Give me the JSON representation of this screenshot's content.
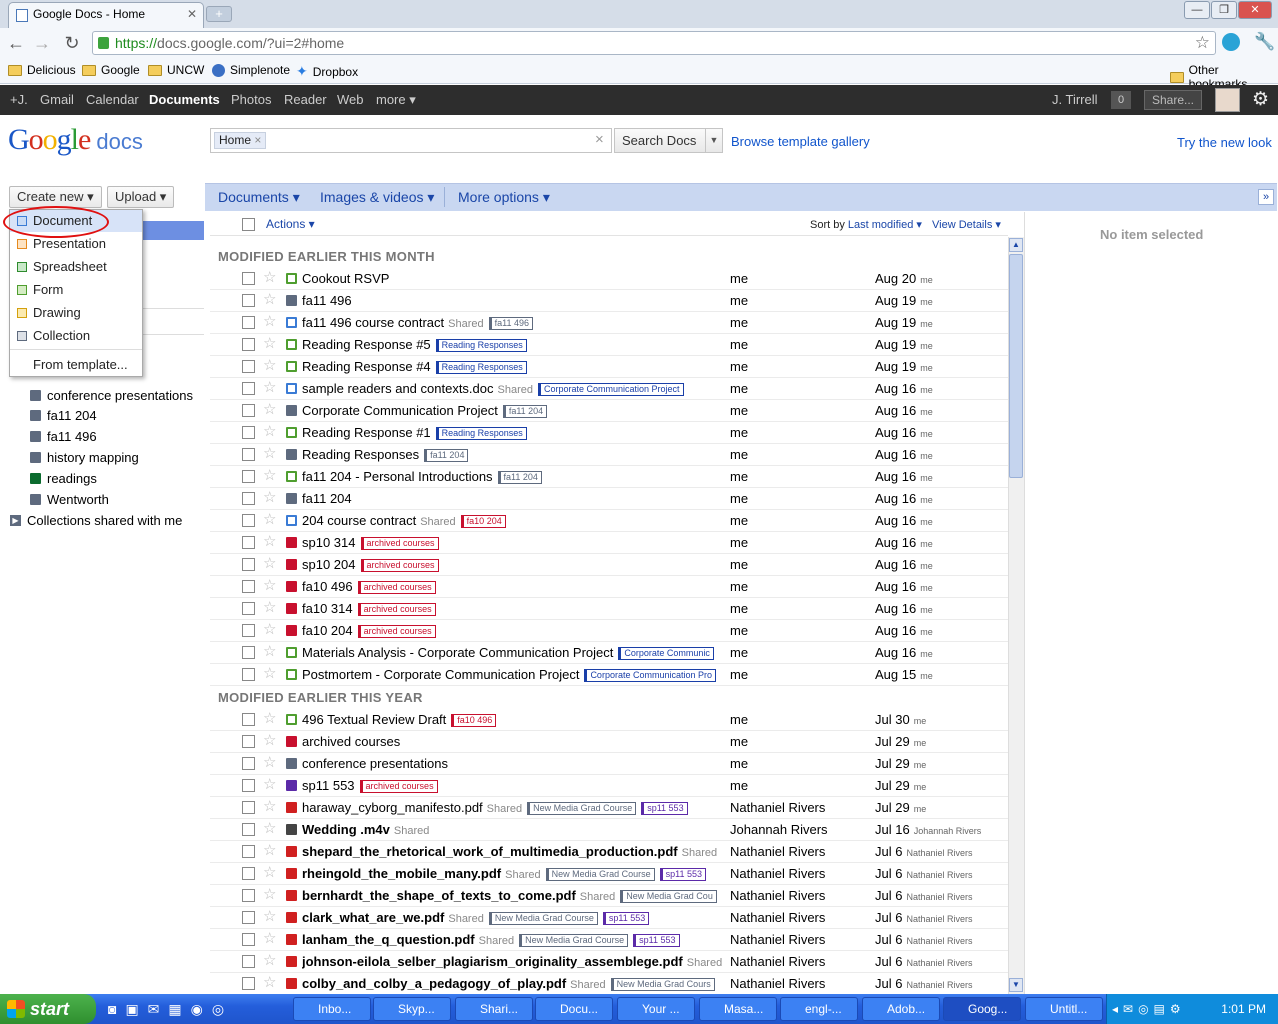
{
  "browser": {
    "tab_title": "Google Docs - Home",
    "url_scheme": "https://",
    "url_rest": "docs.google.com/?ui=2#home",
    "bookmarks": [
      "Delicious",
      "Google",
      "UNCW",
      "Simplenote",
      "Dropbox"
    ],
    "other_bookmarks": "Other bookmarks"
  },
  "gbar": {
    "links": [
      "+J.",
      "Gmail",
      "Calendar",
      "Documents",
      "Photos",
      "Reader",
      "Web",
      "more ▾"
    ],
    "user": "J. Tirrell",
    "count": "0",
    "share": "Share..."
  },
  "header": {
    "logo_google": "Google",
    "logo_docs": "docs",
    "search_chip": "Home",
    "search_button": "Search Docs",
    "browse_templates": "Browse template gallery",
    "try_new_look": "Try the new look"
  },
  "left": {
    "create_new": "Create new ▾",
    "upload": "Upload ▾",
    "menu": [
      "Document",
      "Presentation",
      "Spreadsheet",
      "Form",
      "Drawing",
      "Collection",
      "From template..."
    ],
    "collections": [
      {
        "label": "conference presentations",
        "color": "#5e6a7e"
      },
      {
        "label": "fa11 204",
        "color": "#5e6a7e"
      },
      {
        "label": "fa11 496",
        "color": "#5e6a7e"
      },
      {
        "label": "history mapping",
        "color": "#5e6a7e"
      },
      {
        "label": "readings",
        "color": "#0b6b2e"
      },
      {
        "label": "Wentworth",
        "color": "#5e6a7e"
      }
    ],
    "shared_with_me": "Collections shared with me"
  },
  "menubar": {
    "documents": "Documents ▾",
    "images": "Images & videos ▾",
    "more": "More options ▾"
  },
  "list": {
    "actions": "Actions ▾",
    "sort_prefix": "Sort by",
    "sort_value": "Last modified ▾",
    "view": "View Details ▾",
    "section1": "MODIFIED EARLIER THIS MONTH",
    "section2": "MODIFIED EARLIER THIS YEAR",
    "shared_label": "Shared",
    "rows1": [
      {
        "name": "Cookout RSVP",
        "type": "form",
        "tags": [],
        "owner": "me",
        "date": "Aug 20",
        "by": "me"
      },
      {
        "name": "fa11 496",
        "type": "coll",
        "tags": [],
        "owner": "me",
        "date": "Aug 19",
        "by": "me"
      },
      {
        "name": "fa11 496 course contract",
        "type": "doc",
        "shared": true,
        "tags": [
          "fa11 496"
        ],
        "owner": "me",
        "date": "Aug 19",
        "by": "me"
      },
      {
        "name": "Reading Response #5",
        "type": "form",
        "tags": [
          "Reading Responses"
        ],
        "owner": "me",
        "date": "Aug 19",
        "by": "me"
      },
      {
        "name": "Reading Response #4",
        "type": "form",
        "tags": [
          "Reading Responses"
        ],
        "owner": "me",
        "date": "Aug 19",
        "by": "me"
      },
      {
        "name": "sample readers and contexts.doc",
        "type": "doc",
        "shared": true,
        "tags": [
          "Corporate Communication Project"
        ],
        "owner": "me",
        "date": "Aug 16",
        "by": "me"
      },
      {
        "name": "Corporate Communication Project",
        "type": "coll",
        "tags": [
          "fa11 204"
        ],
        "owner": "me",
        "date": "Aug 16",
        "by": "me"
      },
      {
        "name": "Reading Response #1",
        "type": "form",
        "tags": [
          "Reading Responses"
        ],
        "owner": "me",
        "date": "Aug 16",
        "by": "me"
      },
      {
        "name": "Reading Responses",
        "type": "coll",
        "tags": [
          "fa11 204"
        ],
        "owner": "me",
        "date": "Aug 16",
        "by": "me"
      },
      {
        "name": "fa11 204 - Personal Introductions",
        "type": "form",
        "tags": [
          "fa11 204"
        ],
        "owner": "me",
        "date": "Aug 16",
        "by": "me"
      },
      {
        "name": "fa11 204",
        "type": "coll",
        "tags": [],
        "owner": "me",
        "date": "Aug 16",
        "by": "me"
      },
      {
        "name": "204 course contract",
        "type": "doc",
        "shared": true,
        "tags": [
          "fa10 204"
        ],
        "owner": "me",
        "date": "Aug 16",
        "by": "me"
      },
      {
        "name": "sp10 314",
        "type": "red",
        "tags": [
          "archived courses"
        ],
        "owner": "me",
        "date": "Aug 16",
        "by": "me"
      },
      {
        "name": "sp10 204",
        "type": "red",
        "tags": [
          "archived courses"
        ],
        "owner": "me",
        "date": "Aug 16",
        "by": "me"
      },
      {
        "name": "fa10 496",
        "type": "red",
        "tags": [
          "archived courses"
        ],
        "owner": "me",
        "date": "Aug 16",
        "by": "me"
      },
      {
        "name": "fa10 314",
        "type": "red",
        "tags": [
          "archived courses"
        ],
        "owner": "me",
        "date": "Aug 16",
        "by": "me"
      },
      {
        "name": "fa10 204",
        "type": "red",
        "tags": [
          "archived courses"
        ],
        "owner": "me",
        "date": "Aug 16",
        "by": "me"
      },
      {
        "name": "Materials Analysis - Corporate Communication Project",
        "type": "form",
        "tags": [
          "Corporate Communic"
        ],
        "owner": "me",
        "date": "Aug 16",
        "by": "me"
      },
      {
        "name": "Postmortem - Corporate Communication Project",
        "type": "form",
        "tags": [
          "Corporate Communication Pro"
        ],
        "owner": "me",
        "date": "Aug 15",
        "by": "me"
      }
    ],
    "rows2": [
      {
        "name": "496 Textual Review Draft",
        "type": "form",
        "tags": [
          "fa10 496"
        ],
        "owner": "me",
        "date": "Jul 30",
        "by": "me"
      },
      {
        "name": "archived courses",
        "type": "red",
        "tags": [],
        "owner": "me",
        "date": "Jul 29",
        "by": "me"
      },
      {
        "name": "conference presentations",
        "type": "coll",
        "tags": [],
        "owner": "me",
        "date": "Jul 29",
        "by": "me"
      },
      {
        "name": "sp11 553",
        "type": "purple",
        "tags": [
          "archived courses"
        ],
        "owner": "me",
        "date": "Jul 29",
        "by": "me"
      },
      {
        "name": "haraway_cyborg_manifesto.pdf",
        "type": "pdf",
        "shared": true,
        "tags": [
          "New Media Grad Course",
          "sp11 553"
        ],
        "owner": "Nathaniel Rivers",
        "date": "Jul 29",
        "by": "me"
      },
      {
        "name": "Wedding .m4v",
        "type": "vid",
        "bold": true,
        "shared": true,
        "tags": [],
        "owner": "Johannah Rivers",
        "date": "Jul 16",
        "by": "Johannah Rivers"
      },
      {
        "name": "shepard_the_rhetorical_work_of_multimedia_production.pdf",
        "type": "pdf",
        "bold": true,
        "shared": true,
        "tags": [],
        "owner": "Nathaniel Rivers",
        "date": "Jul 6",
        "by": "Nathaniel Rivers"
      },
      {
        "name": "rheingold_the_mobile_many.pdf",
        "type": "pdf",
        "bold": true,
        "shared": true,
        "tags": [
          "New Media Grad Course",
          "sp11 553"
        ],
        "owner": "Nathaniel Rivers",
        "date": "Jul 6",
        "by": "Nathaniel Rivers"
      },
      {
        "name": "bernhardt_the_shape_of_texts_to_come.pdf",
        "type": "pdf",
        "bold": true,
        "shared": true,
        "tags": [
          "New Media Grad Cou"
        ],
        "owner": "Nathaniel Rivers",
        "date": "Jul 6",
        "by": "Nathaniel Rivers"
      },
      {
        "name": "clark_what_are_we.pdf",
        "type": "pdf",
        "bold": true,
        "shared": true,
        "tags": [
          "New Media Grad Course",
          "sp11 553"
        ],
        "owner": "Nathaniel Rivers",
        "date": "Jul 6",
        "by": "Nathaniel Rivers"
      },
      {
        "name": "lanham_the_q_question.pdf",
        "type": "pdf",
        "bold": true,
        "shared": true,
        "tags": [
          "New Media Grad Course",
          "sp11 553"
        ],
        "owner": "Nathaniel Rivers",
        "date": "Jul 6",
        "by": "Nathaniel Rivers"
      },
      {
        "name": "johnson-eilola_selber_plagiarism_originality_assemblege.pdf",
        "type": "pdf",
        "bold": true,
        "shared": true,
        "tags": [],
        "owner": "Nathaniel Rivers",
        "date": "Jul 6",
        "by": "Nathaniel Rivers"
      },
      {
        "name": "colby_and_colby_a_pedagogy_of_play.pdf",
        "type": "pdf",
        "bold": true,
        "shared": true,
        "tags": [
          "New Media Grad Cours"
        ],
        "owner": "Nathaniel Rivers",
        "date": "Jul 6",
        "by": "Nathaniel Rivers"
      }
    ]
  },
  "right_panel": {
    "empty": "No item selected"
  },
  "taskbar": {
    "start": "start",
    "items": [
      "Inbo...",
      "Skyp...",
      "Shari...",
      "Docu...",
      "Your ...",
      "Masa...",
      "engl-...",
      "Adob...",
      "Goog...",
      "Untitl..."
    ],
    "clock": "1:01 PM"
  },
  "colors": {
    "doc": "#3a7bd5",
    "form": "#4f9e2f",
    "coll": "#5e6a7e",
    "red": "#c8102e",
    "purple": "#5b2aa8",
    "pdf": "#d02020",
    "accent_link": "#1155cc"
  }
}
